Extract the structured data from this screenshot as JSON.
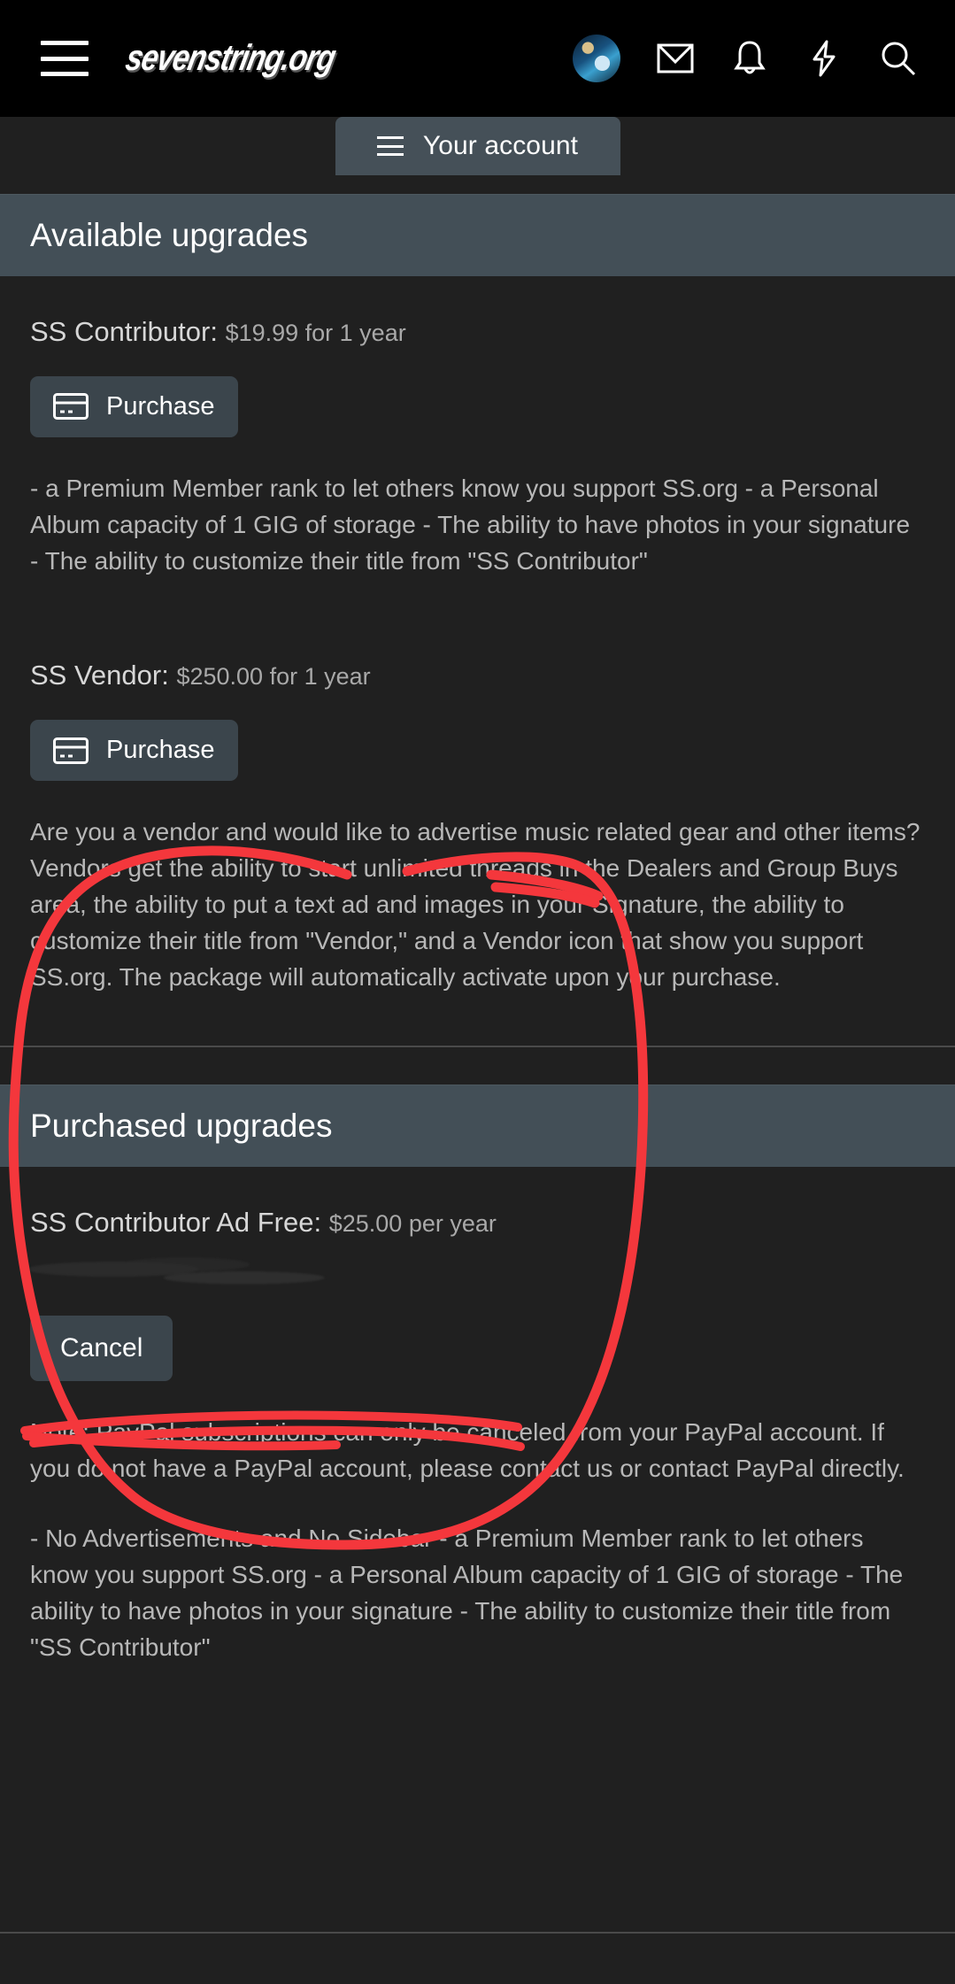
{
  "navbar": {
    "brand": "sevenstring.org",
    "menu_icon": "hamburger-icon",
    "avatar_icon": "user-avatar",
    "inbox_icon": "envelope-icon",
    "alerts_icon": "bell-icon",
    "activity_icon": "lightning-bolt-icon",
    "search_icon": "search-icon"
  },
  "account_tab": {
    "label": "Your account",
    "icon": "hamburger-icon"
  },
  "available": {
    "header": "Available upgrades",
    "items": [
      {
        "name": "SS Contributor:",
        "price": "$19.99 for 1 year",
        "button": "Purchase",
        "button_icon": "credit-card-icon",
        "description": "- a Premium Member rank to let others know you support SS.org - a Personal Album capacity of 1 GIG of storage - The ability to have photos in your signature - The ability to customize their title from \"SS Contributor\""
      },
      {
        "name": "SS Vendor:",
        "price": "$250.00 for 1 year",
        "button": "Purchase",
        "button_icon": "credit-card-icon",
        "description": "Are you a vendor and would like to advertise music related gear and other items? Vendors get the ability to start unlimited threads in the Dealers and Group Buys area, the ability to put a text ad and images in your Signature, the ability to customize their title from \"Vendor,\" and a Vendor icon that show you support SS.org. The package will automatically activate upon your purchase."
      }
    ]
  },
  "purchased": {
    "header": "Purchased upgrades",
    "item": {
      "name": "SS Contributor Ad Free:",
      "price": "$25.00 per year",
      "redacted_note": "",
      "button": "Cancel",
      "note": "Note: PayPal subscriptions can only be canceled from your PayPal account. If you do not have a PayPal account, please contact us or contact PayPal directly.",
      "description": "- No Advertisements and No Sidebar - a Premium Member rank to let others know you support SS.org - a Personal Album capacity of 1 GIG of storage - The ability to have photos in your signature - The ability to customize their title from \"SS Contributor\""
    }
  },
  "annotation": {
    "type": "hand-drawn-circle",
    "color": "#f4373c"
  },
  "colors": {
    "navbar_bg": "#000000",
    "page_bg": "#202020",
    "section_header_bg": "#434f57",
    "button_bg": "#3b454c",
    "body_text": "#b8b8b8",
    "heading_text": "#ffffff",
    "annotation_red": "#f4373c"
  }
}
